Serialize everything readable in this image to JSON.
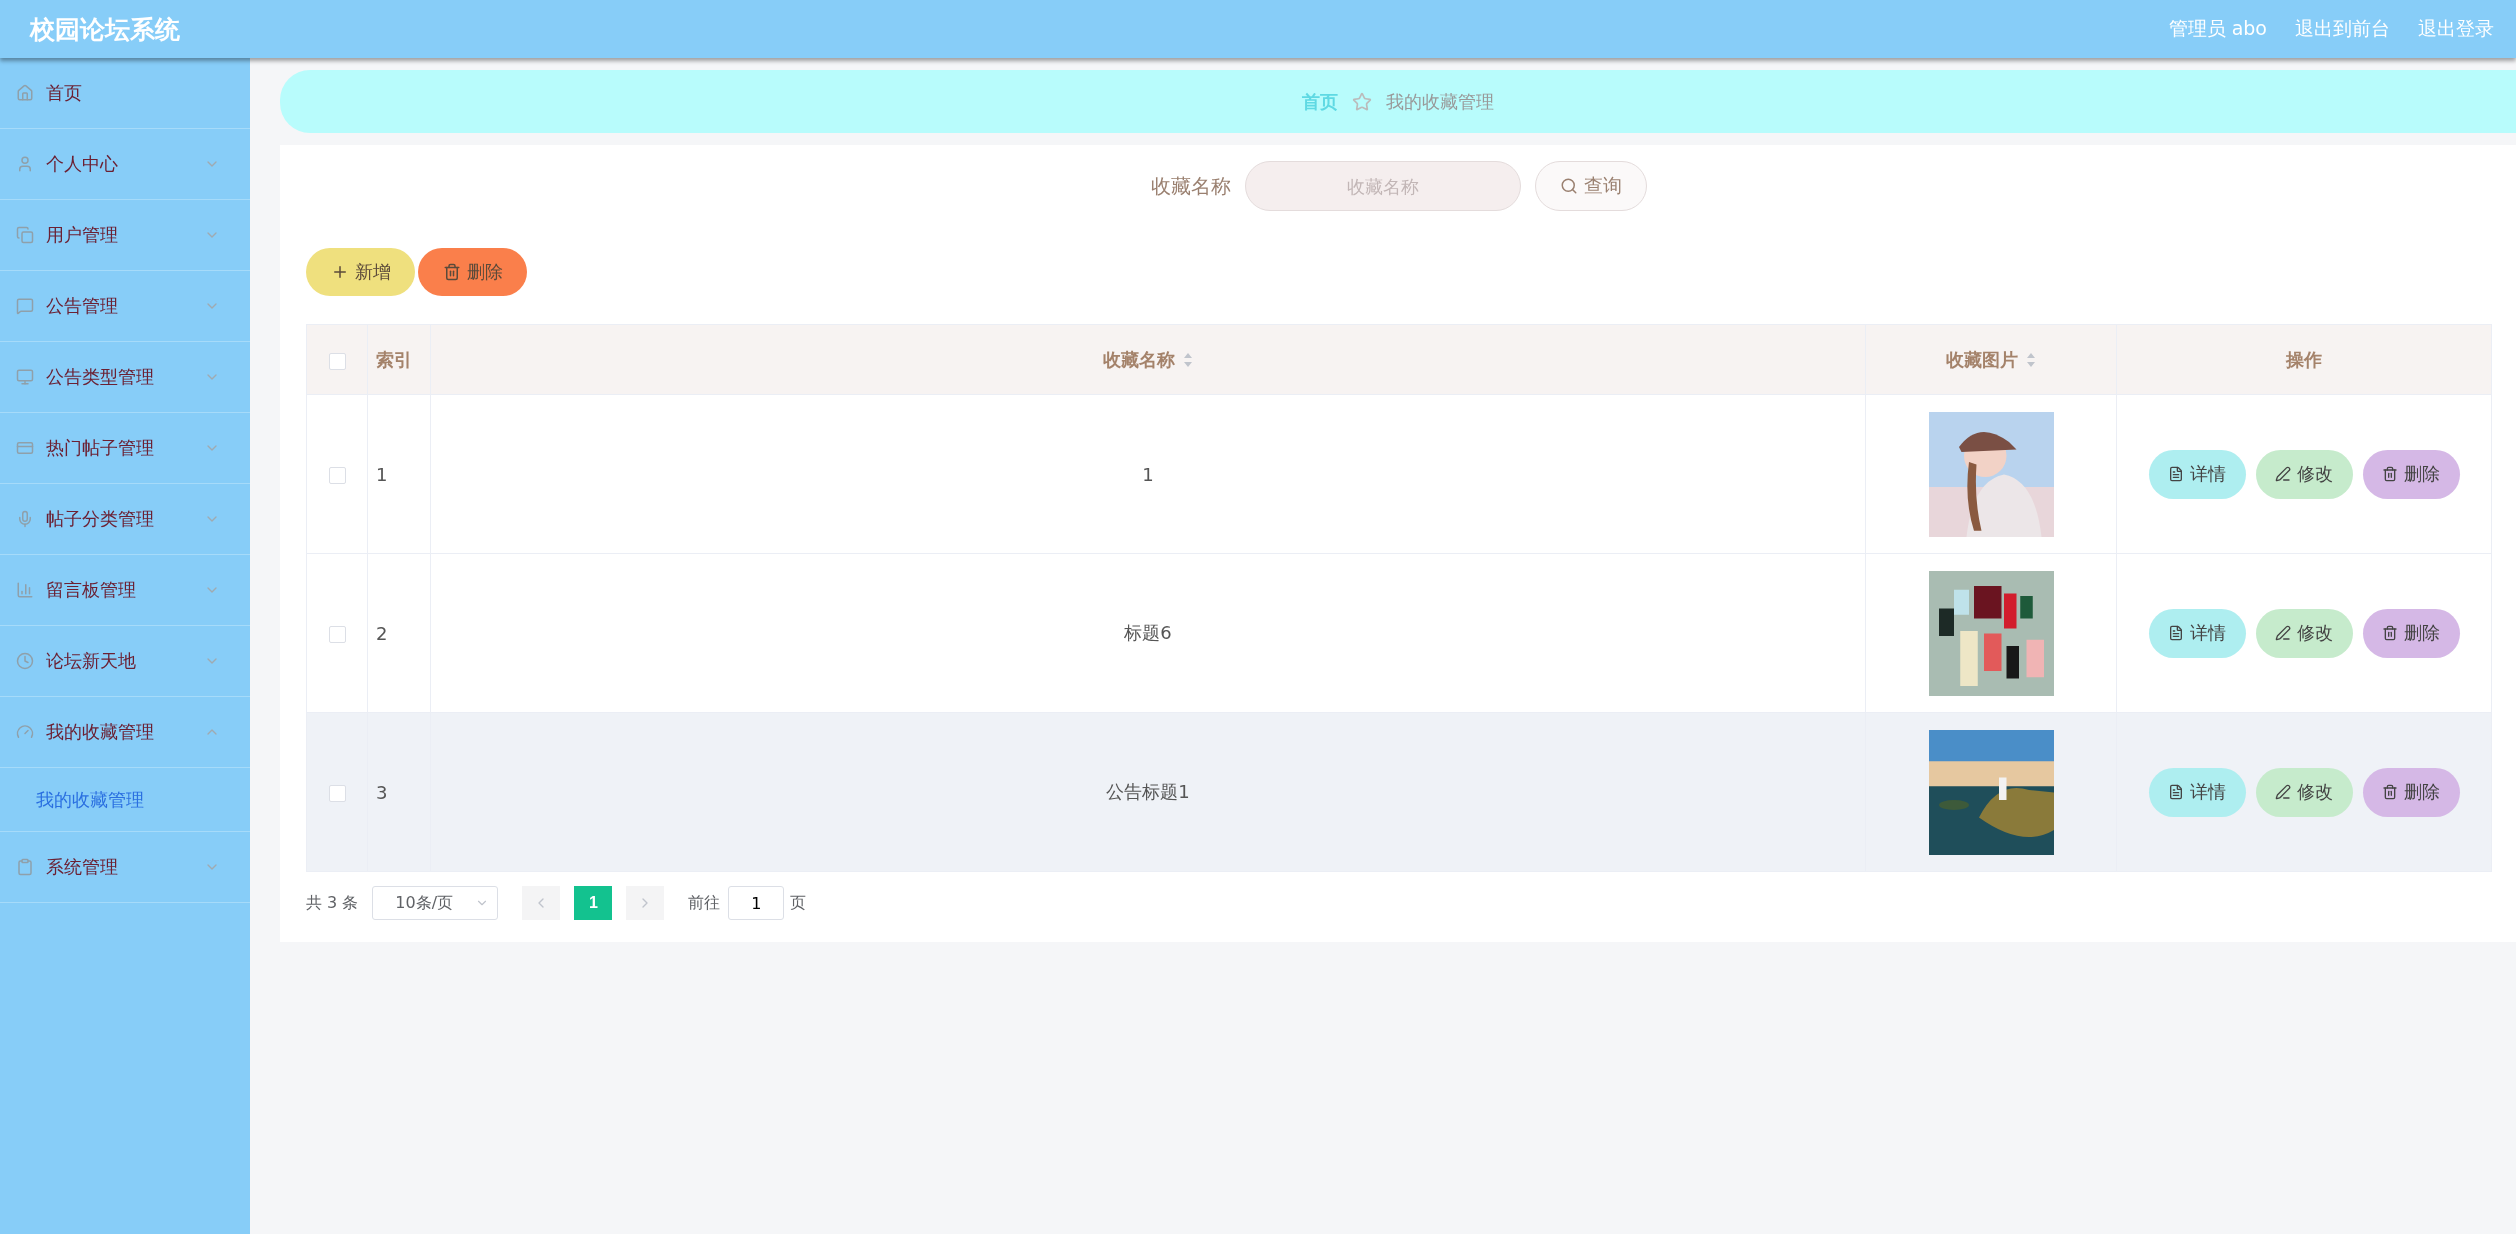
{
  "header": {
    "title": "校园论坛系统",
    "user": "管理员 abo",
    "links": [
      "退出到前台",
      "退出登录"
    ]
  },
  "sidebar": {
    "items": [
      {
        "label": "首页",
        "kind": "link"
      },
      {
        "label": "个人中心",
        "kind": "submenu",
        "expanded": false
      },
      {
        "label": "用户管理",
        "kind": "submenu",
        "expanded": false
      },
      {
        "label": "公告管理",
        "kind": "submenu",
        "expanded": false
      },
      {
        "label": "公告类型管理",
        "kind": "submenu",
        "expanded": false
      },
      {
        "label": "热门帖子管理",
        "kind": "submenu",
        "expanded": false
      },
      {
        "label": "帖子分类管理",
        "kind": "submenu",
        "expanded": false
      },
      {
        "label": "留言板管理",
        "kind": "submenu",
        "expanded": false
      },
      {
        "label": "论坛新天地",
        "kind": "submenu",
        "expanded": false
      },
      {
        "label": "我的收藏管理",
        "kind": "submenu",
        "expanded": true,
        "children": [
          {
            "label": "我的收藏管理",
            "selected": true
          }
        ]
      },
      {
        "label": "系统管理",
        "kind": "submenu",
        "expanded": false
      }
    ]
  },
  "breadcrumb": {
    "home": "首页",
    "current": "我的收藏管理"
  },
  "search": {
    "label": "收藏名称",
    "placeholder": "收藏名称",
    "button": "查询"
  },
  "actions": [
    "新增",
    "删除"
  ],
  "table": {
    "columns": [
      {
        "label": "索引",
        "sortable": false
      },
      {
        "label": "收藏名称",
        "sortable": true
      },
      {
        "label": "收藏图片",
        "sortable": true
      },
      {
        "label": "操作",
        "sortable": false
      }
    ],
    "header_checked": false,
    "rows": [
      {
        "checked": false,
        "highlighted": false,
        "index": "1",
        "name": "1",
        "image": {
          "kind": "picture"
        },
        "buttons": [
          "详情",
          "修改",
          "删除"
        ]
      },
      {
        "checked": false,
        "highlighted": false,
        "index": "2",
        "name": "标题6",
        "image": {
          "kind": "picture"
        },
        "buttons": [
          "详情",
          "修改",
          "删除"
        ]
      },
      {
        "checked": false,
        "highlighted": true,
        "index": "3",
        "name": "公告标题1",
        "image": {
          "kind": "picture"
        },
        "buttons": [
          "详情",
          "修改",
          "删除"
        ]
      }
    ]
  },
  "pagination": {
    "total": "共 3 条",
    "page_size": "10条/页",
    "pages": [
      {
        "label": "1",
        "selected": true
      }
    ],
    "goto": "前往",
    "goto_value": "1",
    "page_suffix": "页"
  }
}
